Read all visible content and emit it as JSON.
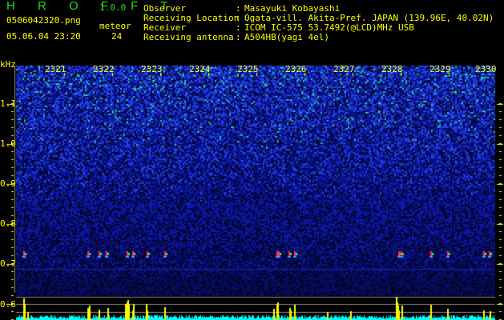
{
  "app": {
    "title": "H R O F F T",
    "version": "1.0.0"
  },
  "file": {
    "name": "0506042320.png",
    "datetime": "05.06.04 23:20"
  },
  "meteor": {
    "label": "meteor",
    "count": "24"
  },
  "info": [
    {
      "label": "Observer",
      "value": "Masayuki Kobayashi"
    },
    {
      "label": "Receiving Location",
      "value": "Ogata-vill. Akita-Pref. JAPAN (139.96E, 40.02N)"
    },
    {
      "label": "Receiver",
      "value": "ICOM IC-575 53.7492(@LCD)MHz USB"
    },
    {
      "label": "Receiving antenna",
      "value": "A504HB(yagi 4el)"
    }
  ],
  "axis": {
    "unit": "kHz",
    "freq_ticks": [
      "1.1",
      "1.0",
      "0.9",
      "0.8",
      "0.7",
      "0.6"
    ],
    "time_ticks": [
      "2321",
      "2322",
      "2323",
      "2324",
      "2325",
      "2326",
      "2327",
      "2328",
      "2329",
      "2330"
    ]
  },
  "colors": {
    "text": "#ffff00",
    "title": "#22dd22",
    "noise": "#0a14a0",
    "level": "#00ffff",
    "meteor": "#ffff00"
  }
}
